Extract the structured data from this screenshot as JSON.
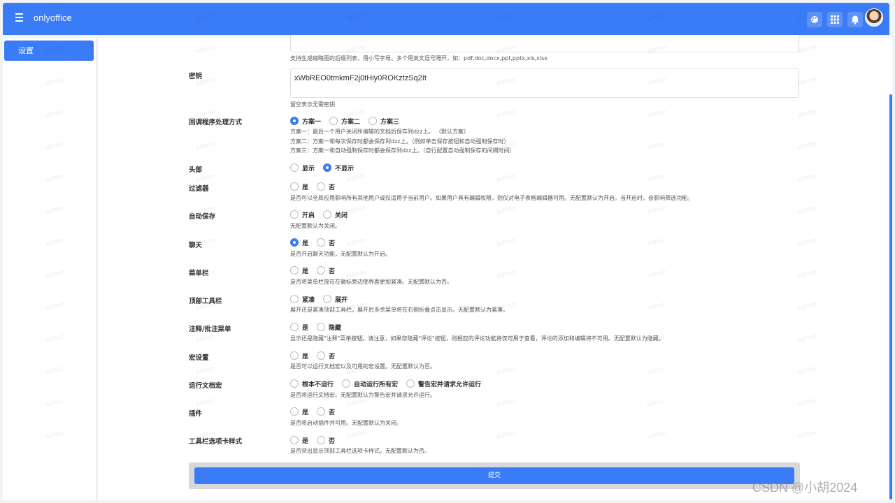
{
  "header": {
    "app_name": "onlyoffice",
    "icons": [
      "hamburger-icon",
      "palette-icon",
      "apps-grid-icon",
      "bell-icon",
      "user-avatar"
    ]
  },
  "sidebar": {
    "items": [
      {
        "label": "设置",
        "active": true
      }
    ]
  },
  "form": {
    "thumbnail_hint": "支持生成缩略图的后缀列表，用小写字母。多个用英文逗号隔开，如：pdf,doc,docx,ppt,pptx,xls,xlsx",
    "secret": {
      "label": "密钥",
      "value": "xWbREO0tmkmF2j0tHiy0ROKztzSq2It",
      "hint": "留空表示无需密钥"
    },
    "callback": {
      "label": "回调程序处理方式",
      "options": [
        "方案一",
        "方案二",
        "方案三"
      ],
      "selected": "方案一",
      "hints": [
        "方案一：最后一个用户关闭所编辑的文档后保存到dzz上。 （默认方案）",
        "方案二：方案一和每次保存时都会保存到dzz上。（例如单击保存按钮和自动强制保存时）",
        "方案三：方案一和自动强制保存时都会保存到dzz上。（自行配置自动强制保存的间隔时间）"
      ]
    },
    "header_opt": {
      "label": "头部",
      "options": [
        "显示",
        "不显示"
      ],
      "selected": "不显示"
    },
    "filter": {
      "label": "过滤器",
      "options": [
        "是",
        "否"
      ],
      "selected": "",
      "hint": "是否可以全局应用影响所有其他用户或仅适用于当前用户。如果用户具有编辑权限，则仅对电子表格编辑器可用。无配置默认为开启。当开启时，会影响筛选功能。"
    },
    "autosave": {
      "label": "自动保存",
      "options": [
        "开启",
        "关闭"
      ],
      "selected": "",
      "hint": "无配置默认为关闭。"
    },
    "chat": {
      "label": "聊天",
      "options": [
        "是",
        "否"
      ],
      "selected": "是",
      "hint": "是否开启聊天功能，无配置默认为开启。"
    },
    "menubar": {
      "label": "菜单栏",
      "options": [
        "是",
        "否"
      ],
      "selected": "",
      "hint": "是否将菜单栏放在在徽标旁边使界面更加紧凑。无配置默认为否。"
    },
    "toptoolbar": {
      "label": "顶部工具栏",
      "options": [
        "紧凑",
        "展开"
      ],
      "selected": "",
      "hint": "展开还是紧凑顶部工具栏。展开后多余菜单将在右侧折叠点击显示。无配置默认为紧凑。"
    },
    "comments": {
      "label": "注释/批注菜单",
      "options": [
        "是",
        "隐藏"
      ],
      "selected": "",
      "hint": "显示还是隐藏\"注释\"菜单按钮。请注意，如果您隐藏\"评论\"按钮，则相应的评论功能将仅可用于查看，评论的添加和编辑将不可用。无配置默认为隐藏。"
    },
    "macros_settings": {
      "label": "宏设置",
      "options": [
        "是",
        "否"
      ],
      "selected": "",
      "hint": "是否可以运行文档宏以及可用的宏设置。无配置默认为否。"
    },
    "run_macros": {
      "label": "运行文档宏",
      "options": [
        "根本不运行",
        "自动运行所有宏",
        "警告宏并请求允许运行"
      ],
      "selected": "",
      "hint": "是否将运行文档宏。无配置默认为警告宏并请求允许运行。"
    },
    "plugins": {
      "label": "插件",
      "options": [
        "是",
        "否"
      ],
      "selected": "",
      "hint": "是否将启动插件并可用。无配置默认为关闭。"
    },
    "toolbar_tabs": {
      "label": "工具栏选项卡样式",
      "options": [
        "是",
        "否"
      ],
      "selected": "",
      "hint": "是否突出显示顶部工具栏选项卡样式。无配置默认为否。"
    },
    "submit_label": "提交"
  },
  "watermark_text": "admin",
  "corner_watermark": "CSDN @小胡2024"
}
